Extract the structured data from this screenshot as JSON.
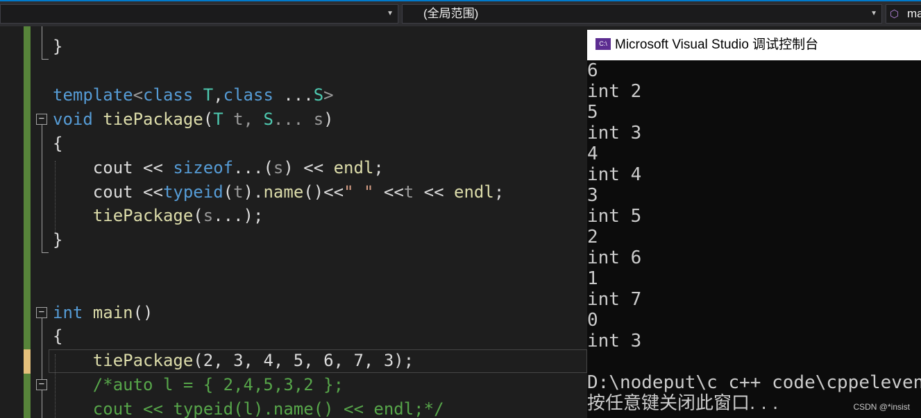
{
  "navbar": {
    "scope_label": "(全局范围)",
    "member_label": "ma",
    "member_icon": "member-cube-icon"
  },
  "editor": {
    "line_close_prev": "}",
    "line_template": {
      "kw1": "template",
      "lt": "<",
      "kw2": "class",
      "t": "T",
      "comma": ",",
      "kw3": "class",
      "ellipsis": " ...",
      "s": "S",
      "gt": ">"
    },
    "line_signature": {
      "void": "void",
      "name": "tiePackage",
      "open": "(",
      "t_type": "T",
      "t_param": " t, ",
      "s_type": "S",
      "s_param": "... s",
      "close": ")"
    },
    "line_open1": "{",
    "line_cout1": {
      "cout": "cout",
      "op": " << ",
      "sizeof": "sizeof",
      "args": "...(",
      "s": "s",
      "after": ") << ",
      "endl": "endl",
      "end": ";"
    },
    "line_cout2": {
      "cout": "cout",
      "op": " <<",
      "typeid": "typeid",
      "args": "(",
      "t": "t",
      "mid": ").",
      "name": "name",
      "after": "()<<",
      "str": "\" \"",
      "op2": " <<",
      "t2": "t",
      "op3": " << ",
      "endl": "endl",
      "end": ";"
    },
    "line_recur": {
      "name": "tiePackage",
      "open": "(",
      "s": "s",
      "rest": "...);"
    },
    "line_close1": "}",
    "line_main": {
      "int": "int",
      "main": " main",
      "paren": "()"
    },
    "line_open2": "{",
    "line_call": {
      "name": "tiePackage",
      "args": "(2, 3, 4, 5, 6, 7, 3);"
    },
    "line_comment1": "/*auto l = { 2,4,5,3,2 };",
    "line_comment2": "cout << typeid(l).name() << endl;*/"
  },
  "console": {
    "title": "Microsoft Visual Studio 调试控制台",
    "icon_label": "C:\\",
    "output": [
      "6",
      "int 2",
      "5",
      "int 3",
      "4",
      "int 4",
      "3",
      "int 5",
      "2",
      "int 6",
      "1",
      "int 7",
      "0",
      "int 3"
    ],
    "path_line": "D:\\nodeput\\c c++ code\\cppeleven\\",
    "press_key": "按任意键关闭此窗口. . .",
    "watermark": "CSDN @*insist"
  }
}
